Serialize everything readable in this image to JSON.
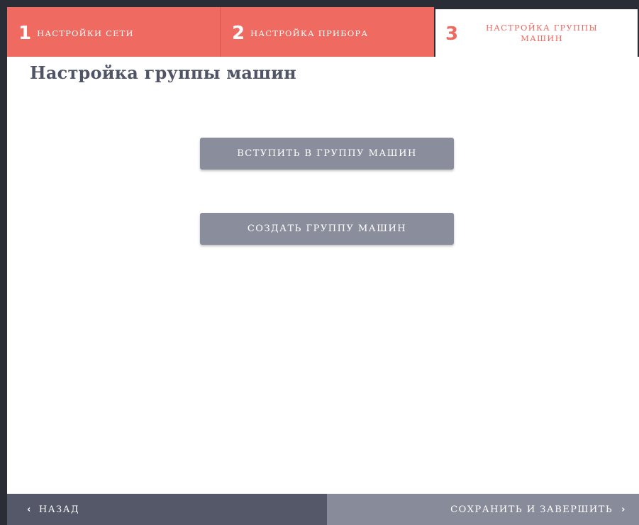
{
  "stepper": {
    "steps": [
      {
        "number": "1",
        "label": "НАСТРОЙКИ СЕТИ"
      },
      {
        "number": "2",
        "label": "НАСТРОЙКА ПРИБОРА"
      },
      {
        "number": "3",
        "label": "НАСТРОЙКА ГРУППЫ МАШИН"
      }
    ],
    "active_step": 3
  },
  "main": {
    "title": "Настройка группы машин",
    "join_button": "ВСТУПИТЬ В ГРУППУ МАШИН",
    "create_button": "СОЗДАТЬ ГРУППУ МАШИН"
  },
  "footer": {
    "back_label": "НАЗАД",
    "back_icon": "‹",
    "finish_label": "СОХРАНИТЬ И ЗАВЕРШИТЬ",
    "finish_icon": "›"
  },
  "colors": {
    "accent": "#ef6a60",
    "button": "#8a8d9c",
    "title": "#4f5466",
    "footer_dark": "#545869",
    "footer_light": "#888b9a"
  }
}
